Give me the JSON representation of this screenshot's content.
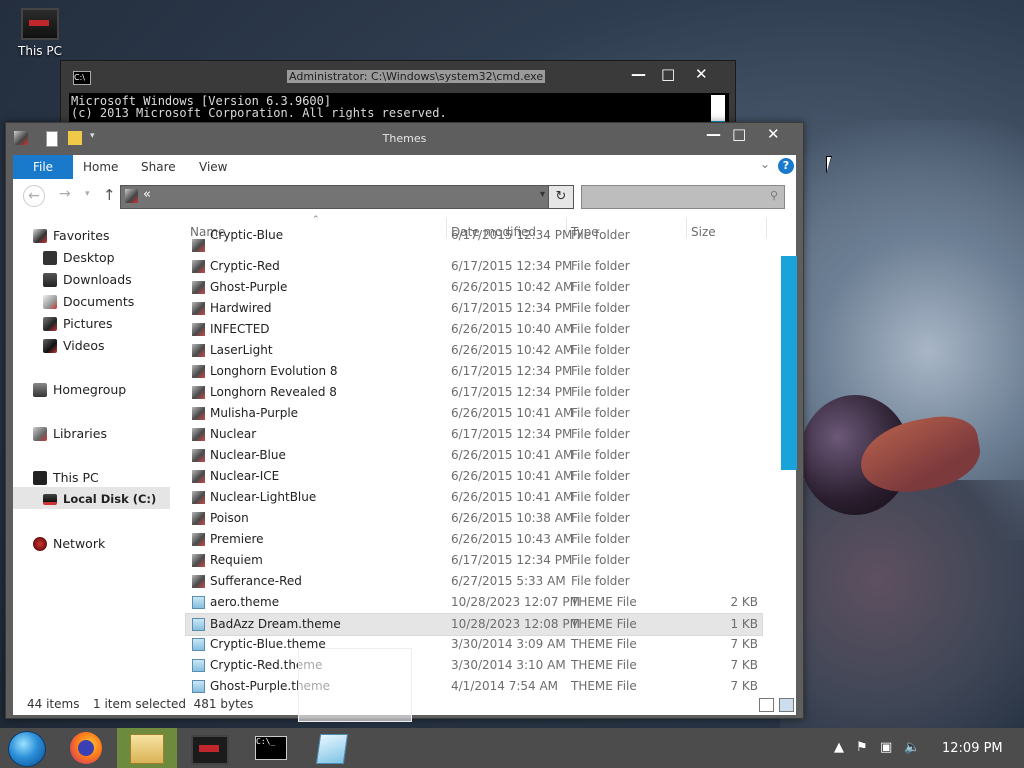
{
  "desktop": {
    "this_pc_label": "This PC"
  },
  "cmd": {
    "title": "Administrator: C:\\Windows\\system32\\cmd.exe",
    "line1": "Microsoft Windows [Version 6.3.9600]",
    "line2": "(c) 2013 Microsoft Corporation. All rights reserved.",
    "minimize": "—",
    "maximize": "□",
    "close": "✕"
  },
  "explorer": {
    "title": "Themes",
    "minimize": "—",
    "maximize": "□",
    "close": "✕",
    "ribbon": {
      "file": "File",
      "home": "Home",
      "share": "Share",
      "view": "View",
      "help": "?"
    },
    "address": {
      "chevrons": "«"
    },
    "nav": {
      "favorites": "Favorites",
      "desktop": "Desktop",
      "downloads": "Downloads",
      "documents": "Documents",
      "pictures": "Pictures",
      "videos": "Videos",
      "homegroup": "Homegroup",
      "libraries": "Libraries",
      "this_pc": "This PC",
      "local_disk": "Local Disk (C:)",
      "network": "Network"
    },
    "columns": {
      "name": "Name",
      "date": "Date modified",
      "type": "Type",
      "size": "Size"
    },
    "files": [
      {
        "name": "Cryptic-Blue",
        "date": "6/17/2015 12:34 PM",
        "type": "File folder",
        "size": "",
        "kind": "folder"
      },
      {
        "name": "Cryptic-Red",
        "date": "6/17/2015 12:34 PM",
        "type": "File folder",
        "size": "",
        "kind": "folder"
      },
      {
        "name": "Ghost-Purple",
        "date": "6/26/2015 10:42 AM",
        "type": "File folder",
        "size": "",
        "kind": "folder"
      },
      {
        "name": "Hardwired",
        "date": "6/17/2015 12:34 PM",
        "type": "File folder",
        "size": "",
        "kind": "folder"
      },
      {
        "name": "INFECTED",
        "date": "6/26/2015 10:40 AM",
        "type": "File folder",
        "size": "",
        "kind": "folder"
      },
      {
        "name": "LaserLight",
        "date": "6/26/2015 10:42 AM",
        "type": "File folder",
        "size": "",
        "kind": "folder"
      },
      {
        "name": "Longhorn Evolution 8",
        "date": "6/17/2015 12:34 PM",
        "type": "File folder",
        "size": "",
        "kind": "folder"
      },
      {
        "name": "Longhorn Revealed 8",
        "date": "6/17/2015 12:34 PM",
        "type": "File folder",
        "size": "",
        "kind": "folder"
      },
      {
        "name": "Mulisha-Purple",
        "date": "6/26/2015 10:41 AM",
        "type": "File folder",
        "size": "",
        "kind": "folder"
      },
      {
        "name": "Nuclear",
        "date": "6/17/2015 12:34 PM",
        "type": "File folder",
        "size": "",
        "kind": "folder"
      },
      {
        "name": "Nuclear-Blue",
        "date": "6/26/2015 10:41 AM",
        "type": "File folder",
        "size": "",
        "kind": "folder"
      },
      {
        "name": "Nuclear-ICE",
        "date": "6/26/2015 10:41 AM",
        "type": "File folder",
        "size": "",
        "kind": "folder"
      },
      {
        "name": "Nuclear-LightBlue",
        "date": "6/26/2015 10:41 AM",
        "type": "File folder",
        "size": "",
        "kind": "folder"
      },
      {
        "name": "Poison",
        "date": "6/26/2015 10:38 AM",
        "type": "File folder",
        "size": "",
        "kind": "folder"
      },
      {
        "name": "Premiere",
        "date": "6/26/2015 10:43 AM",
        "type": "File folder",
        "size": "",
        "kind": "folder"
      },
      {
        "name": "Requiem",
        "date": "6/17/2015 12:34 PM",
        "type": "File folder",
        "size": "",
        "kind": "folder"
      },
      {
        "name": "Sufferance-Red",
        "date": "6/27/2015 5:33 AM",
        "type": "File folder",
        "size": "",
        "kind": "folder"
      },
      {
        "name": "aero.theme",
        "date": "10/28/2023 12:07 PM",
        "type": "THEME File",
        "size": "2 KB",
        "kind": "theme"
      },
      {
        "name": "BadAzz Dream.theme",
        "date": "10/28/2023 12:08 PM",
        "type": "THEME File",
        "size": "1 KB",
        "kind": "theme",
        "selected": true
      },
      {
        "name": "Cryptic-Blue.theme",
        "date": "3/30/2014 3:09 AM",
        "type": "THEME File",
        "size": "7 KB",
        "kind": "theme"
      },
      {
        "name": "Cryptic-Red.theme",
        "date": "3/30/2014 3:10 AM",
        "type": "THEME File",
        "size": "7 KB",
        "kind": "theme"
      },
      {
        "name": "Ghost-Purple.theme",
        "date": "4/1/2014 7:54 AM",
        "type": "THEME File",
        "size": "7 KB",
        "kind": "theme"
      }
    ],
    "status": {
      "count": "44 items",
      "selection": "1 item selected  481 bytes"
    }
  },
  "taskbar": {
    "clock": "12:09 PM"
  },
  "colors": {
    "accent": "#1979ca",
    "scrollbar": "#1aa3db",
    "taskbar_active": "#6e8a3d"
  }
}
